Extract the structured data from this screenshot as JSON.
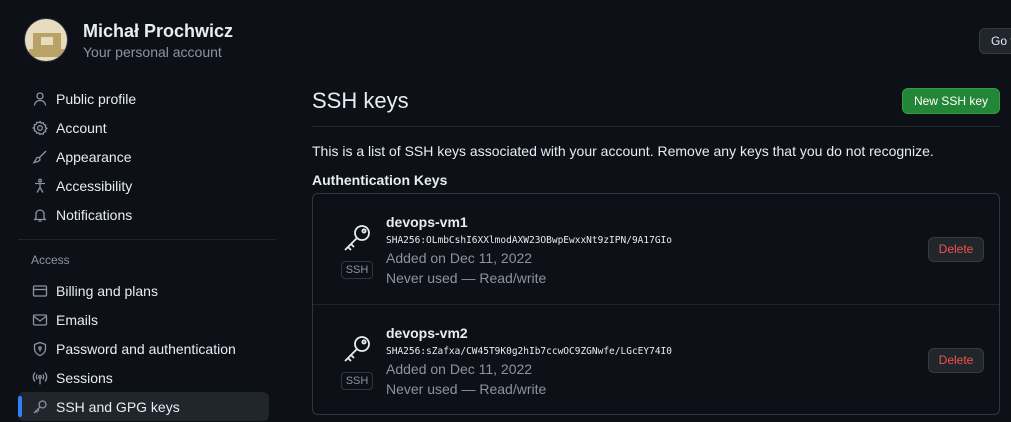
{
  "profile": {
    "name": "Michał Prochwicz",
    "subtitle": "Your personal account",
    "goto_label": "Go t"
  },
  "sidebar": {
    "items": [
      {
        "label": "Public profile",
        "icon": "person-icon"
      },
      {
        "label": "Account",
        "icon": "gear-icon"
      },
      {
        "label": "Appearance",
        "icon": "paintbrush-icon"
      },
      {
        "label": "Accessibility",
        "icon": "accessibility-icon"
      },
      {
        "label": "Notifications",
        "icon": "bell-icon"
      }
    ],
    "access_heading": "Access",
    "access_items": [
      {
        "label": "Billing and plans",
        "icon": "credit-card-icon"
      },
      {
        "label": "Emails",
        "icon": "mail-icon"
      },
      {
        "label": "Password and authentication",
        "icon": "shield-lock-icon"
      },
      {
        "label": "Sessions",
        "icon": "broadcast-icon"
      },
      {
        "label": "SSH and GPG keys",
        "icon": "key-icon",
        "active": true
      }
    ]
  },
  "main": {
    "title": "SSH keys",
    "new_key_label": "New SSH key",
    "description": "This is a list of SSH keys associated with your account. Remove any keys that you do not recognize.",
    "section_heading": "Authentication Keys",
    "keys": [
      {
        "title": "devops-vm1",
        "fingerprint": "SHA256:OLmbCshI6XXlmodAXW23OBwpEwxxNt9zIPN/9A17GIo",
        "added": "Added on Dec 11, 2022",
        "usage": "Never used — Read/write",
        "type_label": "SSH",
        "delete_label": "Delete"
      },
      {
        "title": "devops-vm2",
        "fingerprint": "SHA256:sZafxa/CW45T9K0g2hIb7ccwOC9ZGNwfe/LGcEY74I0",
        "added": "Added on Dec 11, 2022",
        "usage": "Never used — Read/write",
        "type_label": "SSH",
        "delete_label": "Delete"
      }
    ]
  },
  "colors": {
    "background": "#0d1117",
    "accent_green": "#238636",
    "danger": "#f85149",
    "active_marker": "#2f81f7"
  }
}
